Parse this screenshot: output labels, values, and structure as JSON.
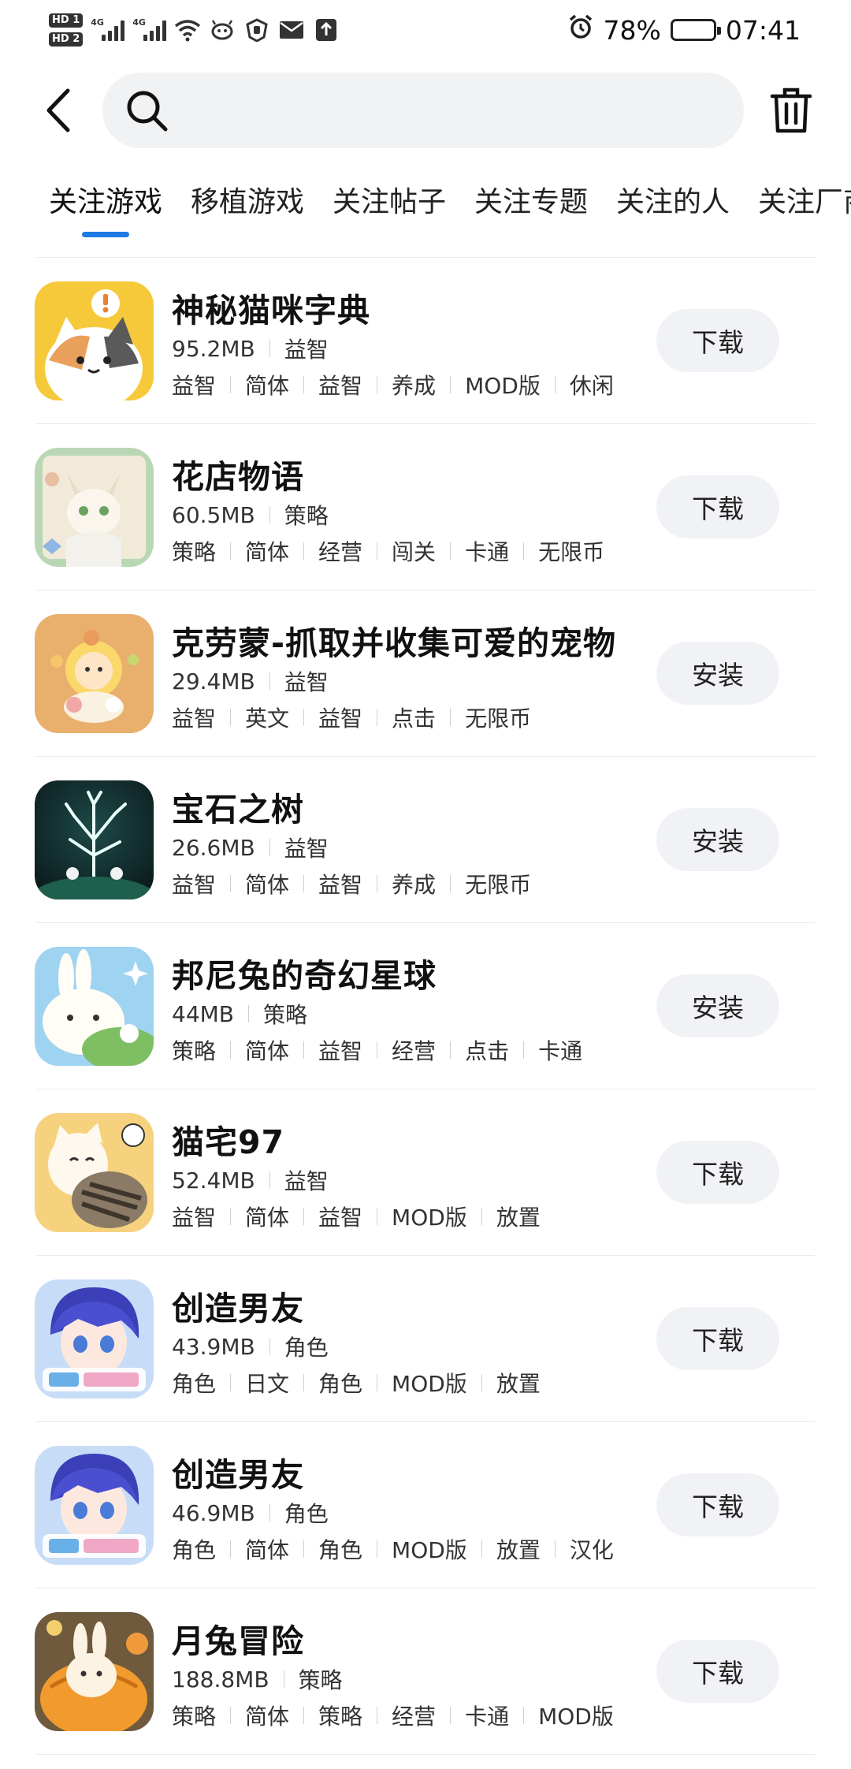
{
  "status_bar": {
    "hd1": "HD 1",
    "hd2": "HD 2",
    "net1": "4G",
    "net2": "4G",
    "battery_pct": "78%",
    "battery_level": 0.78,
    "time": "07:41"
  },
  "search": {
    "placeholder": "",
    "value": ""
  },
  "tabs": [
    {
      "label": "关注游戏"
    },
    {
      "label": "移植游戏"
    },
    {
      "label": "关注帖子"
    },
    {
      "label": "关注专题"
    },
    {
      "label": "关注的人"
    },
    {
      "label": "关注厂商"
    }
  ],
  "games": [
    {
      "title": "神秘猫咪字典",
      "size": "95.2MB",
      "category": "益智",
      "tags": [
        "益智",
        "简体",
        "益智",
        "养成",
        "MOD版",
        "休闲"
      ],
      "action": "下载",
      "icon": "cat-dictionary-icon"
    },
    {
      "title": "花店物语",
      "size": "60.5MB",
      "category": "策略",
      "tags": [
        "策略",
        "简体",
        "经营",
        "闯关",
        "卡通",
        "无限币"
      ],
      "action": "下载",
      "icon": "flower-shop-icon"
    },
    {
      "title": "克劳蒙-抓取并收集可爱的宠物",
      "size": "29.4MB",
      "category": "益智",
      "tags": [
        "益智",
        "英文",
        "益智",
        "点击",
        "无限币"
      ],
      "action": "安装",
      "icon": "pet-collect-icon"
    },
    {
      "title": "宝石之树",
      "size": "26.6MB",
      "category": "益智",
      "tags": [
        "益智",
        "简体",
        "益智",
        "养成",
        "无限币"
      ],
      "action": "安装",
      "icon": "gem-tree-icon"
    },
    {
      "title": "邦尼兔的奇幻星球",
      "size": "44MB",
      "category": "策略",
      "tags": [
        "策略",
        "简体",
        "益智",
        "经营",
        "点击",
        "卡通"
      ],
      "action": "安装",
      "icon": "bunny-planet-icon"
    },
    {
      "title": "猫宅97",
      "size": "52.4MB",
      "category": "益智",
      "tags": [
        "益智",
        "简体",
        "益智",
        "MOD版",
        "放置"
      ],
      "action": "下载",
      "icon": "cat-house-icon"
    },
    {
      "title": "创造男友",
      "size": "43.9MB",
      "category": "角色",
      "tags": [
        "角色",
        "日文",
        "角色",
        "MOD版",
        "放置"
      ],
      "action": "下载",
      "icon": "create-boyfriend-icon"
    },
    {
      "title": "创造男友",
      "size": "46.9MB",
      "category": "角色",
      "tags": [
        "角色",
        "简体",
        "角色",
        "MOD版",
        "放置",
        "汉化"
      ],
      "action": "下载",
      "icon": "create-boyfriend-icon"
    },
    {
      "title": "月兔冒险",
      "size": "188.8MB",
      "category": "策略",
      "tags": [
        "策略",
        "简体",
        "策略",
        "经营",
        "卡通",
        "MOD版"
      ],
      "action": "下载",
      "icon": "moon-rabbit-icon"
    }
  ],
  "colors": {
    "accent": "#1f7be3",
    "button_bg": "#f1f2f5",
    "search_bg": "#f1f2f4"
  }
}
